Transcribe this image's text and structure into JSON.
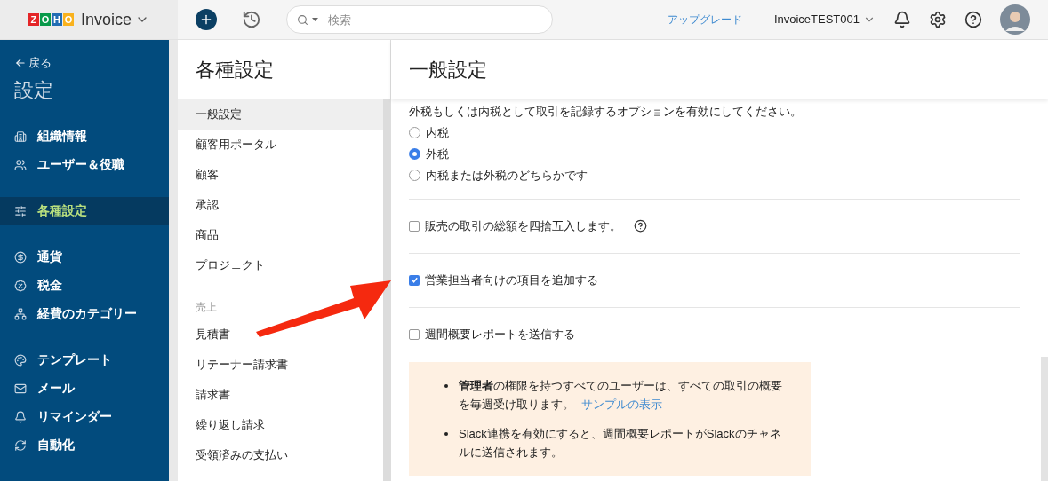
{
  "topbar": {
    "logo_letters": [
      "Z",
      "O",
      "H",
      "O"
    ],
    "product": "Invoice",
    "search": {
      "placeholder": "検索"
    },
    "upgrade": "アップグレード",
    "organization": "InvoiceTEST001"
  },
  "sidebar": {
    "back": "戻る",
    "title": "設定",
    "groups": [
      [
        {
          "label": "組織情報",
          "selected": false
        },
        {
          "label": "ユーザー＆役職",
          "selected": false
        }
      ],
      [
        {
          "label": "各種設定",
          "selected": true
        }
      ],
      [
        {
          "label": "通貨",
          "selected": false
        },
        {
          "label": "税金",
          "selected": false
        },
        {
          "label": "経費のカテゴリー",
          "selected": false
        }
      ],
      [
        {
          "label": "テンプレート",
          "selected": false
        },
        {
          "label": "メール",
          "selected": false
        },
        {
          "label": "リマインダー",
          "selected": false
        },
        {
          "label": "自動化",
          "selected": false
        }
      ]
    ]
  },
  "preferences": {
    "title": "各種設定",
    "sections": [
      {
        "items": [
          {
            "label": "一般設定",
            "selected": true
          },
          {
            "label": "顧客用ポータル",
            "selected": false
          },
          {
            "label": "顧客",
            "selected": false
          },
          {
            "label": "承認",
            "selected": false
          },
          {
            "label": "商品",
            "selected": false
          },
          {
            "label": "プロジェクト",
            "selected": false
          }
        ]
      },
      {
        "heading": "売上",
        "items": [
          {
            "label": "見積書",
            "selected": false
          },
          {
            "label": "リテーナー請求書",
            "selected": false
          },
          {
            "label": "請求書",
            "selected": false
          },
          {
            "label": "繰り返し請求",
            "selected": false
          },
          {
            "label": "受領済みの支払い",
            "selected": false
          }
        ]
      }
    ]
  },
  "general": {
    "title": "一般設定",
    "intro": "外税もしくは内税として取引を記録するオプションを有効にしてください。",
    "tax_options": [
      {
        "label": "内税",
        "selected": false
      },
      {
        "label": "外税",
        "selected": true
      },
      {
        "label": "内税または外税のどちらかです",
        "selected": false
      }
    ],
    "options": [
      {
        "label": "販売の取引の総額を四捨五入します。",
        "checked": false,
        "help": true
      },
      {
        "label": "営業担当者向けの項目を追加する",
        "checked": true
      },
      {
        "label": "週間概要レポートを送信する",
        "checked": false
      }
    ],
    "note": [
      {
        "text": "**管理者**の権限を持つすべてのユーザーは、すべての取引の概要を毎週受け取ります。",
        "link": "サンプルの表示"
      },
      {
        "text": "Slack連携を有効にすると、週間概要レポートがSlackのチャネルに送信されます。"
      }
    ]
  }
}
